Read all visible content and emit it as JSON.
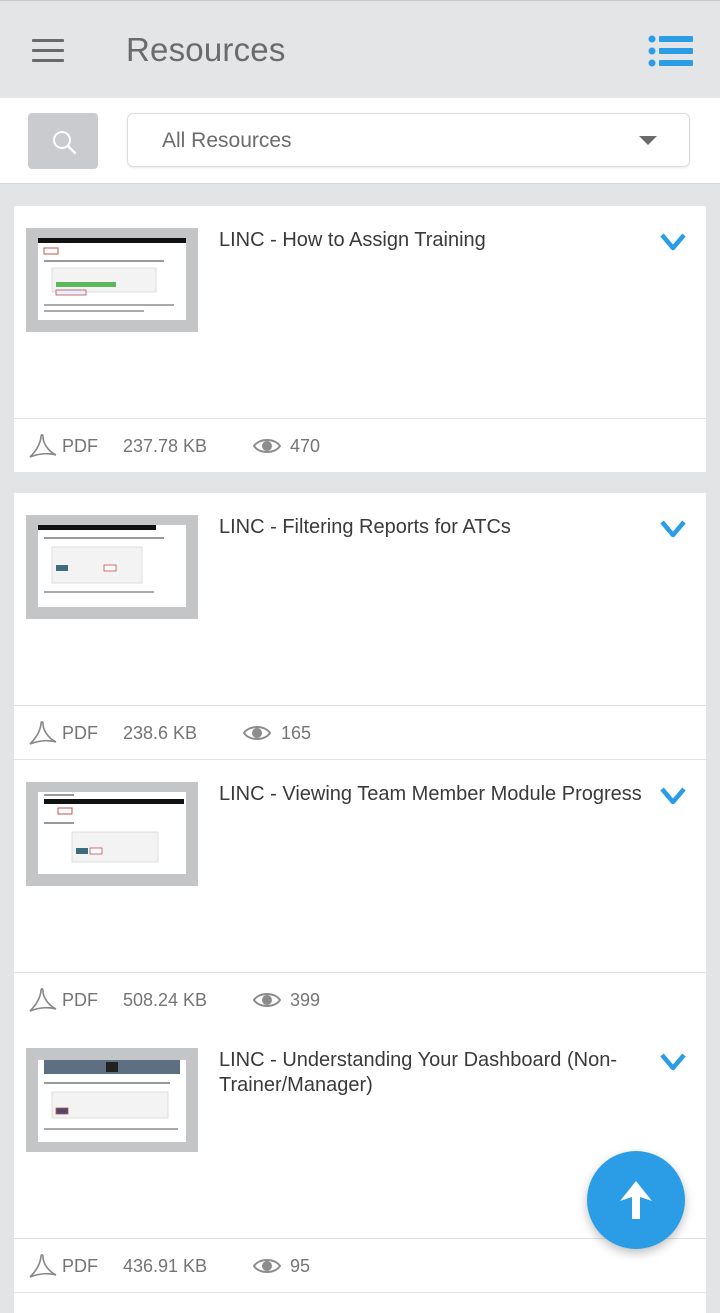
{
  "header": {
    "title": "Resources"
  },
  "filter": {
    "selected": "All Resources"
  },
  "colors": {
    "accent": "#2b9de6",
    "background": "#e3e4e6"
  },
  "resources": [
    {
      "title": "LINC - How to Assign Training",
      "type": "PDF",
      "size": "237.78 KB",
      "views": "470"
    },
    {
      "title": "LINC - Filtering Reports for ATCs",
      "type": "PDF",
      "size": "238.6 KB",
      "views": "165"
    },
    {
      "title": "LINC - Viewing Team Member Module Progress",
      "type": "PDF",
      "size": "508.24 KB",
      "views": "399"
    },
    {
      "title": "LINC - Understanding Your Dashboard (Non-Trainer/Manager)",
      "type": "PDF",
      "size": "436.91 KB",
      "views": "95"
    }
  ],
  "icons": {
    "menu": "hamburger-menu-icon",
    "list_view": "list-view-icon",
    "search": "search-icon",
    "dropdown": "chevron-down-icon",
    "file": "pdf-icon",
    "views": "eye-icon",
    "fab": "arrow-up-icon"
  }
}
